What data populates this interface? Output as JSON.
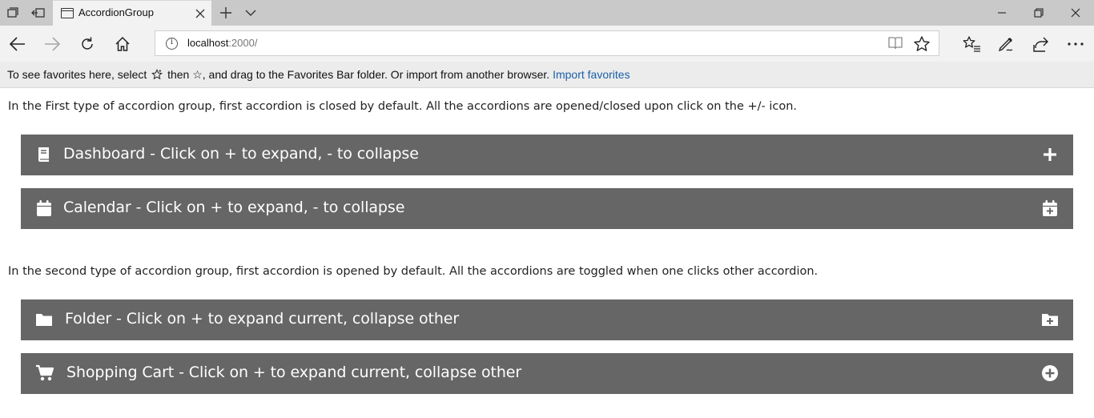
{
  "browser": {
    "tab_title": "AccordionGroup",
    "url_host": "localhost",
    "url_port": ":2000/"
  },
  "favorites_bar": {
    "message_part1": "To see favorites here, select",
    "message_part2": "then ☆, and drag to the Favorites Bar folder. Or import from another browser.",
    "import_link": "Import favorites"
  },
  "group1": {
    "description": "In the First type of accordion group, first accordion is closed by default. All the accordions are opened/closed upon click on the +/- icon.",
    "items": [
      {
        "label": "Dashboard - Click on + to expand, - to collapse",
        "icon": "book-icon",
        "toggle_icon": "plus-icon"
      },
      {
        "label": "Calendar - Click on + to expand, - to collapse",
        "icon": "calendar-icon",
        "toggle_icon": "calendar-plus-icon"
      }
    ]
  },
  "group2": {
    "description": "In the second type of accordion group, first accordion is opened by default. All the accordions are toggled when one clicks other accordion.",
    "items": [
      {
        "label": "Folder - Click on + to expand current, collapse other",
        "icon": "folder-icon",
        "toggle_icon": "folder-plus-icon"
      },
      {
        "label": "Shopping Cart - Click on + to expand current, collapse other",
        "icon": "shopping-cart-icon",
        "toggle_icon": "plus-circle-icon"
      }
    ]
  },
  "colors": {
    "accordion_header_bg": "#666666",
    "accordion_header_text": "#ffffff",
    "link": "#1a5fa8"
  }
}
